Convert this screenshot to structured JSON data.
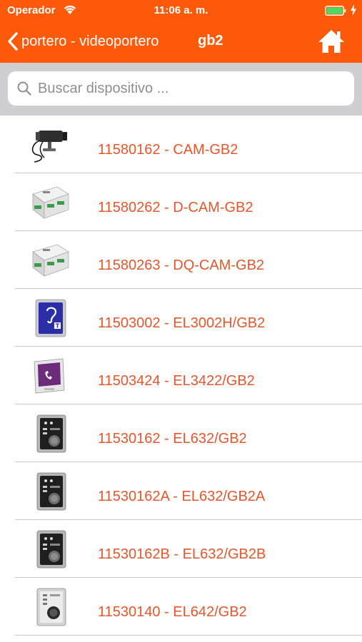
{
  "status_bar": {
    "carrier": "Operador",
    "time": "11:06 a. m."
  },
  "navbar": {
    "back_label": "portero - videoportero",
    "title": "gb2",
    "back_icon": "chevron-left-icon",
    "home_icon": "home-icon"
  },
  "search": {
    "placeholder": "Buscar dispositivo ...",
    "value": ""
  },
  "colors": {
    "header": "#ff5a0a",
    "link_text": "#e4572e",
    "search_band": "#cfcfd3"
  },
  "devices": [
    {
      "label": "11580162 - CAM-GB2",
      "icon": "camera-icon"
    },
    {
      "label": "11580262 - D-CAM-GB2",
      "icon": "din-module-icon"
    },
    {
      "label": "11580263 - DQ-CAM-GB2",
      "icon": "din-module-icon"
    },
    {
      "label": "11503002 - EL3002H/GB2",
      "icon": "hearing-loop-module-icon"
    },
    {
      "label": "11503424 - EL3422/GB2",
      "icon": "video-monitor-icon"
    },
    {
      "label": "11530162 - EL632/GB2",
      "icon": "door-panel-icon"
    },
    {
      "label": "11530162A - EL632/GB2A",
      "icon": "door-panel-icon"
    },
    {
      "label": "11530162B - EL632/GB2B",
      "icon": "door-panel-icon"
    },
    {
      "label": "11530140 - EL642/GB2",
      "icon": "door-panel-icon"
    }
  ]
}
